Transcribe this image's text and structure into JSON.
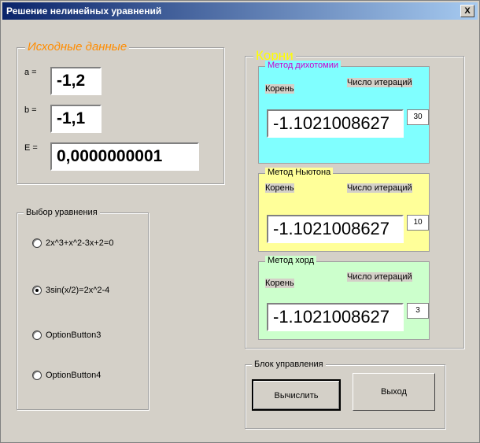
{
  "window": {
    "title": "Решение нелинейных уравнений",
    "close_label": "X"
  },
  "input_frame": {
    "caption": "Исходные данные",
    "caption_color": "#ff8c00",
    "fields": [
      {
        "label": "a =",
        "value": "-1,2"
      },
      {
        "label": "b =",
        "value": "-1,1"
      },
      {
        "label": "E =",
        "value": "0,0000000001"
      }
    ]
  },
  "equation_frame": {
    "caption": "Выбор уравнения",
    "options": [
      {
        "label": "2x^3+x^2-3x+2=0",
        "checked": false
      },
      {
        "label": "3sin(x/2)=2x^2-4",
        "checked": true
      },
      {
        "label": "OptionButton3",
        "checked": false
      },
      {
        "label": "OptionButton4",
        "checked": false
      }
    ]
  },
  "roots_frame": {
    "caption": "Корни",
    "caption_color": "#ffff00",
    "methods": [
      {
        "caption": "Метод дихотомии",
        "caption_color": "#cc00cc",
        "bg": "#80ffff",
        "root_label": "Корень",
        "iter_label": "Число итераций",
        "root_value": "-1.1021008627",
        "iterations": "30"
      },
      {
        "caption": "Метод Ньютона",
        "caption_color": "#000000",
        "bg": "#ffff99",
        "root_label": "Корень",
        "iter_label": "Число итераций",
        "root_value": "-1.1021008627",
        "iterations": "10"
      },
      {
        "caption": "Метод хорд",
        "caption_color": "#000000",
        "bg": "#ccffcc",
        "root_label": "Корень",
        "iter_label": "Число итераций",
        "root_value": "-1.1021008627",
        "iterations": "3"
      }
    ]
  },
  "control_frame": {
    "caption": "Блок управления",
    "compute_label": "Вычислить",
    "exit_label": "Выход"
  }
}
